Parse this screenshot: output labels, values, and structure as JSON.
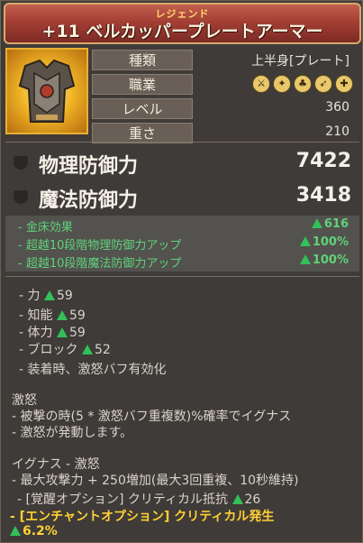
{
  "header": {
    "grade": "レジェンド",
    "title": "+11 ベルカッパープレートアーマー"
  },
  "attributes": [
    {
      "label": "種類",
      "value": "上半身[プレート]"
    },
    {
      "label": "職業",
      "value": ""
    },
    {
      "label": "レベル",
      "value": "360"
    },
    {
      "label": "重さ",
      "value": "210"
    }
  ],
  "class_icons": [
    "sword-icon",
    "wand-icon",
    "claw-icon",
    "bow-icon",
    "cross-icon"
  ],
  "defense": [
    {
      "label": "物理防御力",
      "value": "7422"
    },
    {
      "label": "魔法防御力",
      "value": "3418"
    }
  ],
  "bonuses": [
    {
      "label": "- 金床効果",
      "value": "616"
    },
    {
      "label": "- 超越10段階物理防御力アップ",
      "value": "100%"
    },
    {
      "label": "- 超越10段階魔法防御力アップ",
      "value": "100%"
    }
  ],
  "stats": [
    {
      "label": "- 力",
      "value": "59"
    },
    {
      "label": "- 知能",
      "value": "59"
    },
    {
      "label": "- 体力",
      "value": "59"
    },
    {
      "label": "- ブロック",
      "value": "52"
    }
  ],
  "equip_effect": "- 装着時、激怒バフ有効化",
  "rage": {
    "title": "激怒",
    "line1": "- 被撃の時(5 * 激怒バフ重複数)%確率でイグナス",
    "line2": "- 激怒が発動します。"
  },
  "ignas": {
    "title": "イグナス - 激怒",
    "line1": "- 最大攻撃力 + 250増加(最大3回重複、10秒維持)",
    "awaken_label": "- [覚醒オプション] クリティカル抵抗",
    "awaken_value": "26"
  },
  "enchant": {
    "label": "- [エンチャントオプション] クリティカル発生",
    "value": "6.2%"
  }
}
